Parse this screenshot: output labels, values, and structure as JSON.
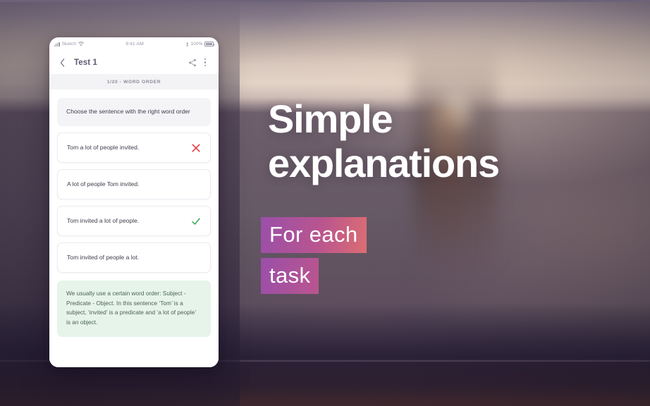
{
  "phone": {
    "status_bar": {
      "carrier": "Sketch",
      "signal_icon": "signal-bars-icon",
      "wifi_icon": "wifi-icon",
      "time": "9:41 AM",
      "bluetooth_icon": "bluetooth-icon",
      "battery_level": "100%",
      "battery_icon": "battery-icon"
    },
    "nav": {
      "back_icon": "chevron-left-icon",
      "title": "Test 1",
      "share_icon": "share-icon",
      "menu_icon": "kebab-menu-icon"
    },
    "progress_label": "1/20 - WORD ORDER",
    "question": "Choose the sentence with the right word order",
    "options": [
      {
        "text": "Tom a lot of people invited.",
        "mark": "cross",
        "mark_icon": "cross-icon"
      },
      {
        "text": "A lot of people Tom invited.",
        "mark": "none",
        "mark_icon": ""
      },
      {
        "text": "Tom invited a lot of people.",
        "mark": "check",
        "mark_icon": "check-icon"
      },
      {
        "text": "Tom invited of people a lot.",
        "mark": "none",
        "mark_icon": ""
      }
    ],
    "explanation": "We usually use a certain word order: Subject - Predicate - Object. In this sentence ‘Tom’ is a subject, ‘invited’ is a predicate and ‘a lot of people’ is an object."
  },
  "marketing": {
    "headline_line1": "Simple",
    "headline_line2": "explanations",
    "sub_line1": "For each",
    "sub_line2": "task"
  },
  "colors": {
    "cross_red": "#e5393f",
    "check_green": "#35a853",
    "explain_bg": "#e6f4ea",
    "highlight_start": "#9a4fa9",
    "highlight_end": "#f4836a",
    "headline_text": "#ffffff"
  }
}
